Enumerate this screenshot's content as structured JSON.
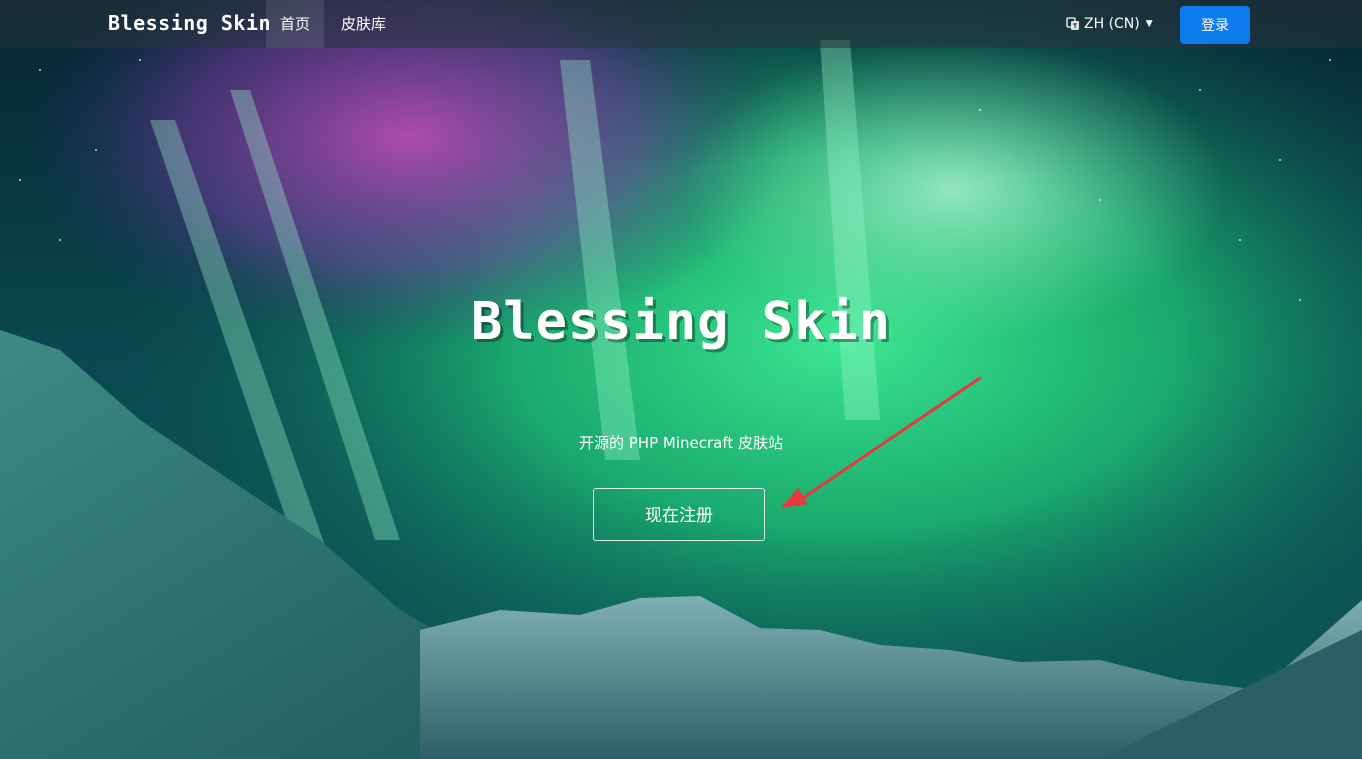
{
  "navbar": {
    "brand": "Blessing Skin",
    "items": [
      {
        "label": "首页",
        "active": true
      },
      {
        "label": "皮肤库",
        "active": false
      }
    ],
    "language": {
      "label": "ZH (CN)",
      "icon": "translate-icon",
      "caret_icon": "caret-down-icon"
    },
    "login_label": "登录"
  },
  "hero": {
    "title": "Blessing Skin",
    "subtitle": "开源的 PHP Minecraft 皮肤站",
    "register_label": "现在注册"
  },
  "colors": {
    "primary": "#0d7bec",
    "nav_bg": "rgba(40,52,60,0.55)",
    "aurora_green": "#2ee87a",
    "aurora_purple": "#b04ac0",
    "annotation_arrow": "#e8383d"
  }
}
